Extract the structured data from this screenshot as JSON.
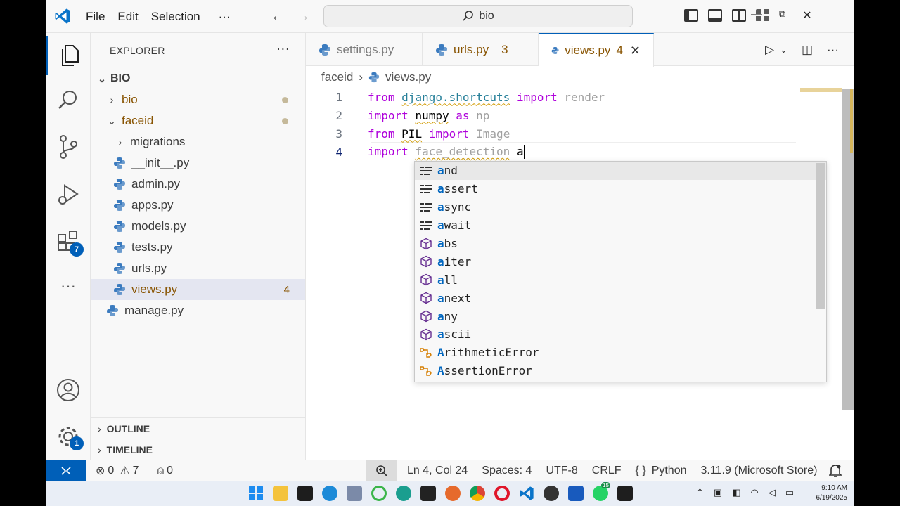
{
  "menu": [
    "File",
    "Edit",
    "Selection",
    "···"
  ],
  "search": {
    "text": "bio"
  },
  "sidebar": {
    "title": "EXPLORER",
    "root": "BIO",
    "items": [
      {
        "label": "bio",
        "type": "folder"
      },
      {
        "label": "faceid",
        "type": "folder"
      },
      {
        "label": "migrations",
        "type": "folder"
      },
      {
        "label": "__init__.py",
        "type": "file"
      },
      {
        "label": "admin.py",
        "type": "file"
      },
      {
        "label": "apps.py",
        "type": "file"
      },
      {
        "label": "models.py",
        "type": "file"
      },
      {
        "label": "tests.py",
        "type": "file"
      },
      {
        "label": "urls.py",
        "type": "file"
      },
      {
        "label": "views.py",
        "type": "file",
        "count": "4"
      },
      {
        "label": "manage.py",
        "type": "file"
      }
    ],
    "outline": "OUTLINE",
    "timeline": "TIMELINE"
  },
  "activity": {
    "extensions_badge": "7",
    "settings_badge": "1"
  },
  "tabs": [
    {
      "label": "settings.py"
    },
    {
      "label": "urls.py",
      "count": "3"
    },
    {
      "label": "views.py",
      "count": "4"
    }
  ],
  "breadcrumb": {
    "folder": "faceid",
    "file": "views.py"
  },
  "editor": {
    "line_numbers": [
      "1",
      "2",
      "3",
      "4"
    ],
    "lines": [
      {
        "kw1": "from",
        "mod": "django.shortcuts",
        "kw2": "import",
        "name": "render"
      },
      {
        "kw1": "import",
        "mod": "numpy",
        "kw2": "as",
        "name": "np"
      },
      {
        "kw1": "from",
        "mod": "PIL",
        "kw2": "import",
        "name": "Image"
      },
      {
        "kw1": "import",
        "mod": "face_detection",
        "typed": "a"
      }
    ]
  },
  "suggestions": [
    {
      "match": "a",
      "rest": "nd",
      "kind": "keyword"
    },
    {
      "match": "a",
      "rest": "ssert",
      "kind": "keyword"
    },
    {
      "match": "a",
      "rest": "sync",
      "kind": "keyword"
    },
    {
      "match": "a",
      "rest": "wait",
      "kind": "keyword"
    },
    {
      "match": "a",
      "rest": "bs",
      "kind": "function"
    },
    {
      "match": "a",
      "rest": "iter",
      "kind": "function"
    },
    {
      "match": "a",
      "rest": "ll",
      "kind": "function"
    },
    {
      "match": "a",
      "rest": "next",
      "kind": "function"
    },
    {
      "match": "a",
      "rest": "ny",
      "kind": "function"
    },
    {
      "match": "a",
      "rest": "scii",
      "kind": "function"
    },
    {
      "match": "A",
      "rest": "rithmeticError",
      "kind": "class"
    },
    {
      "match": "A",
      "rest": "ssertionError",
      "kind": "class"
    }
  ],
  "status": {
    "errors": "0",
    "warnings": "7",
    "ports": "0",
    "position": "Ln 4, Col 24",
    "spaces": "Spaces: 4",
    "encoding": "UTF-8",
    "eol": "CRLF",
    "language": "Python",
    "interpreter": "3.11.9 (Microsoft Store)"
  },
  "taskbar": {
    "time": "9:10 AM",
    "date": "6/19/2025",
    "whatsapp_badge": "15"
  },
  "colors": {
    "accent": "#005fb8",
    "keyword": "#af00db",
    "module": "#267f99",
    "modified": "#895503"
  }
}
